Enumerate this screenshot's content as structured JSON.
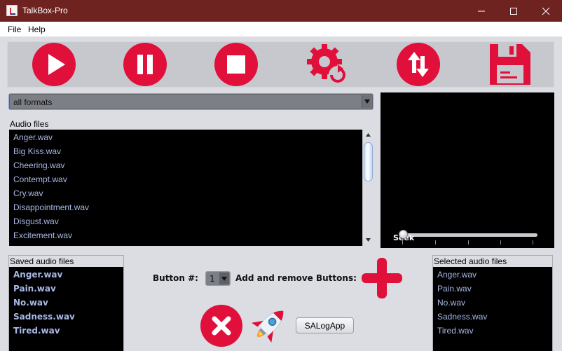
{
  "window": {
    "title": "TalkBox-Pro"
  },
  "menu": [
    "File",
    "Help"
  ],
  "toolbar": {
    "accent": "#e0103a",
    "buttons": [
      "play-icon",
      "pause-icon",
      "stop-icon",
      "settings-refresh-icon",
      "swap-icon",
      "save-icon"
    ]
  },
  "format_filter": {
    "selected": "all formats"
  },
  "audio_files": {
    "label": "Audio files",
    "items": [
      "Anger.wav",
      "Big Kiss.wav",
      "Cheering.wav",
      "Contempt.wav",
      "Cry.wav",
      "Disappointment.wav",
      "Disgust.wav",
      "Excitement.wav"
    ]
  },
  "player": {
    "seek_label": "Seek",
    "seek_position": 0.0
  },
  "saved_audio": {
    "label": "Saved audio files",
    "items": [
      "Anger.wav",
      "Pain.wav",
      "No.wav",
      "Sadness.wav",
      "Tired.wav"
    ]
  },
  "controls": {
    "button_number_label": "Button #:",
    "button_number_value": "1",
    "add_remove_label": "Add and remove Buttons:",
    "salog_label": "SALogApp"
  },
  "selected_audio": {
    "label": "Selected audio files",
    "items": [
      "Anger.wav",
      "Pain.wav",
      "No.wav",
      "Sadness.wav",
      "Tired.wav"
    ]
  }
}
